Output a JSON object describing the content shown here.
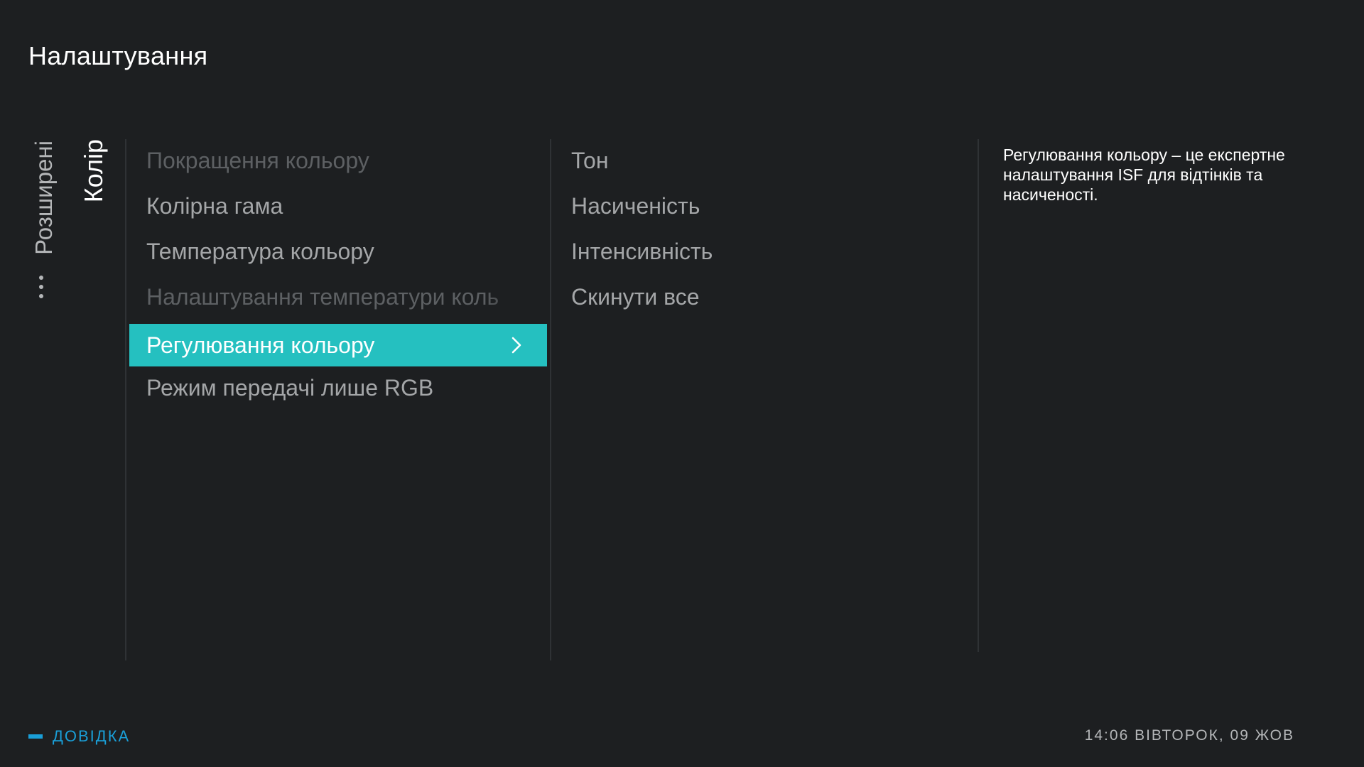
{
  "header": {
    "title": "Налаштування"
  },
  "breadcrumb": {
    "parent": "Розширені",
    "current": "Колір"
  },
  "menu": {
    "items": [
      {
        "label": "Покращення кольору",
        "state": "disabled"
      },
      {
        "label": "Колірна гама",
        "state": "normal"
      },
      {
        "label": "Температура кольору",
        "state": "normal"
      },
      {
        "label": "Налаштування температури коль",
        "state": "disabled"
      },
      {
        "label": "Регулювання кольору",
        "state": "selected"
      },
      {
        "label": "Режим передачі лише RGB",
        "state": "normal"
      }
    ]
  },
  "submenu": {
    "items": [
      {
        "label": "Тон"
      },
      {
        "label": "Насиченість"
      },
      {
        "label": "Інтенсивність"
      },
      {
        "label": "Скинути все"
      }
    ]
  },
  "description": {
    "text": "Регулювання кольору – це експертне налаштування ISF для відтінків та насиченості."
  },
  "footer": {
    "help_label": "ДОВІДКА",
    "clock": "14:06 ВІВТОРОК, 09 ЖОВ"
  },
  "icons": {
    "selected_item": "chevron-right-icon",
    "more": "more-dots-icon",
    "help_key": "blue-key-icon"
  },
  "colors": {
    "background": "#1d1f21",
    "selection": "#25c0c0",
    "help_accent": "#1a9fd8",
    "text_primary": "#ffffff",
    "text_secondary": "#a4a6a8",
    "text_disabled": "#5d6063"
  }
}
